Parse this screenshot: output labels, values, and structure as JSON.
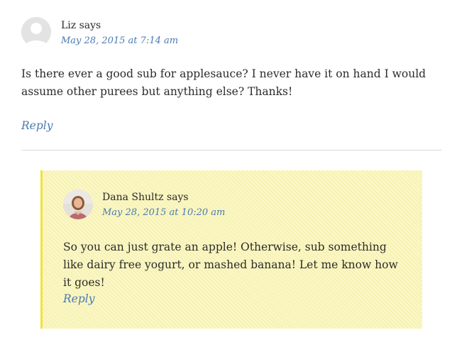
{
  "comments": [
    {
      "author": "Liz",
      "says": "says",
      "date": "May 28, 2015 at 7:14 am",
      "body": "Is there ever a good sub for applesauce? I never have it on hand I would assume other purees but anything else? Thanks!",
      "reply_label": "Reply",
      "avatar": "default-avatar-icon"
    },
    {
      "author": "Dana Shultz",
      "says": "says",
      "date": "May 28, 2015 at 10:20 am",
      "body": "So you can just grate an apple! Otherwise, sub something like dairy free yogurt, or mashed banana! Let me know how it goes!",
      "reply_label": "Reply",
      "avatar": "author-photo"
    }
  ],
  "colors": {
    "link": "#4a7ab0",
    "highlight_bg": "#fbf7c4",
    "highlight_border": "#f0e23a",
    "divider": "#d9d9d9"
  }
}
